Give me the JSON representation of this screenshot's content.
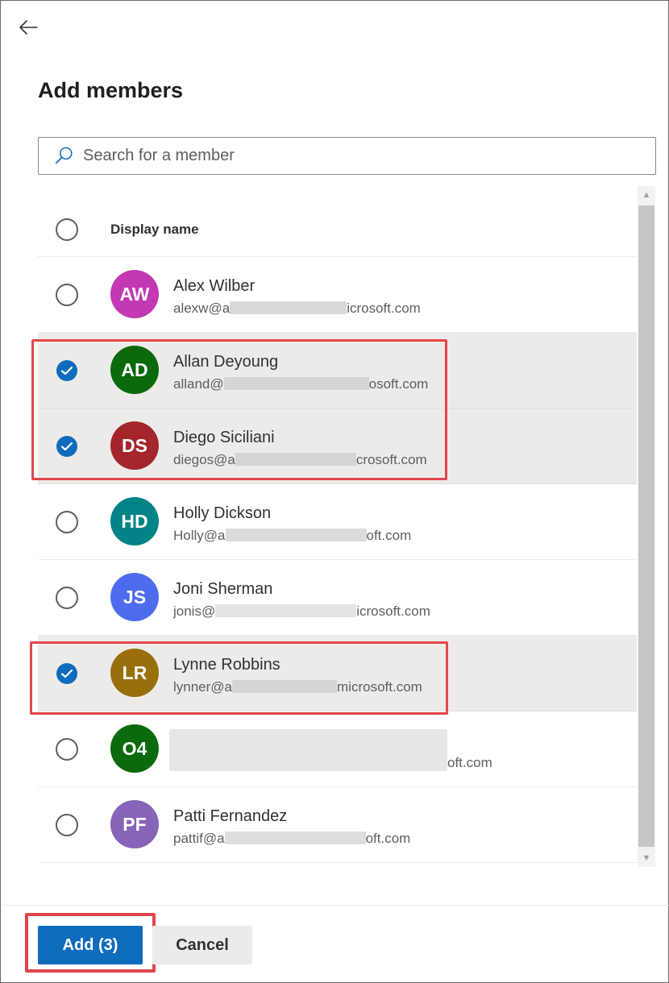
{
  "panel": {
    "title": "Add members",
    "back_label": "Back"
  },
  "search": {
    "placeholder": "Search for a member",
    "value": ""
  },
  "table": {
    "column_header": "Display name",
    "rows": [
      {
        "initials": "AW",
        "name": "Alex Wilber",
        "email_start": "alexw@a",
        "email_end": "icrosoft.com",
        "avatar_color": "#c239b3",
        "selected": false
      },
      {
        "initials": "AD",
        "name": "Allan Deyoung",
        "email_start": "alland@",
        "email_end": "osoft.com",
        "avatar_color": "#0b6a0b",
        "selected": true
      },
      {
        "initials": "DS",
        "name": "Diego Siciliani",
        "email_start": "diegos@a",
        "email_end": "crosoft.com",
        "avatar_color": "#a4262c",
        "selected": true
      },
      {
        "initials": "HD",
        "name": "Holly Dickson",
        "email_start": "Holly@a",
        "email_end": "oft.com",
        "avatar_color": "#038387",
        "selected": false
      },
      {
        "initials": "JS",
        "name": "Joni Sherman",
        "email_start": "jonis@",
        "email_end": "icrosoft.com",
        "avatar_color": "#4f6bed",
        "selected": false
      },
      {
        "initials": "LR",
        "name": "Lynne Robbins",
        "email_start": "lynner@a",
        "email_end": "microsoft.com",
        "avatar_color": "#986f0b",
        "selected": true
      },
      {
        "initials": "O4",
        "name": "",
        "email_start": "",
        "email_end": "oft.com",
        "avatar_color": "#0b6a0b",
        "selected": false
      },
      {
        "initials": "PF",
        "name": "Patti Fernandez",
        "email_start": "pattif@a",
        "email_end": "oft.com",
        "avatar_color": "#8764b8",
        "selected": false
      }
    ]
  },
  "footer": {
    "add_label": "Add (3)",
    "cancel_label": "Cancel"
  },
  "colors": {
    "accent": "#0f6cbd",
    "highlight": "#e0474c",
    "selected_row": "#edebe9"
  },
  "icons": {
    "back": "arrow-left-icon",
    "search": "search-icon",
    "check": "checkmark-icon"
  }
}
